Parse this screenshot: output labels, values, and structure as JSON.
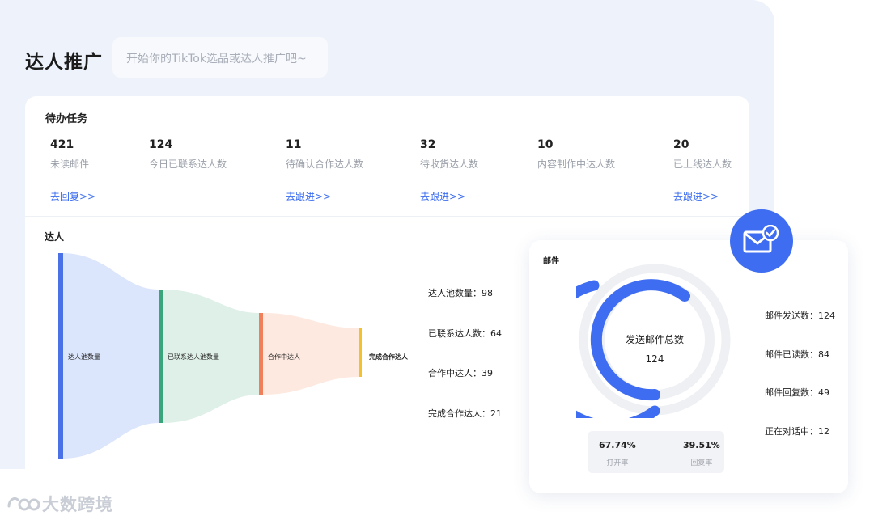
{
  "header": {
    "title": "达人推广",
    "search_placeholder": "开始你的TikTok选品或达人推广吧~"
  },
  "tasks": {
    "heading": "待办任务",
    "items": [
      {
        "count": "421",
        "label": "未读邮件",
        "link": "去回复>>"
      },
      {
        "count": "124",
        "label": "今日已联系达人数",
        "link": ""
      },
      {
        "count": "11",
        "label": "待确认合作达人数",
        "link": "去跟进>>"
      },
      {
        "count": "32",
        "label": "待收货达人数",
        "link": "去跟进>>"
      },
      {
        "count": "10",
        "label": "内容制作中达人数",
        "link": ""
      },
      {
        "count": "20",
        "label": "已上线达人数",
        "link": "去跟进>>"
      }
    ]
  },
  "influencers": {
    "heading": "达人",
    "funnel": [
      {
        "label": "达人池数量",
        "color": "#4a72e6",
        "band": "#dbe5fb"
      },
      {
        "label": "已联系达人池数量",
        "color": "#3aa47a",
        "band": "#dff0e8"
      },
      {
        "label": "合作中达人",
        "color": "#f07f5a",
        "band": "#fde9e0"
      },
      {
        "label": "完成合作达人",
        "color": "#f2c12e",
        "band": ""
      }
    ],
    "stats": [
      "达人池数量：98",
      "已联系达人数：64",
      "合作中达人：39",
      "完成合作达人：21"
    ]
  },
  "mail": {
    "heading": "邮件",
    "center_title": "发送邮件总数",
    "center_value": "124",
    "stats": [
      "邮件发送数：124",
      "邮件已读数：84",
      "邮件回复数：49",
      "正在对话中：12"
    ],
    "open_rate_value": "67.74%",
    "open_rate_label": "打开率",
    "reply_rate_value": "39.51%",
    "reply_rate_label": "回复率",
    "accent": "#3f6df2",
    "track": "#eef0f4",
    "icon": "mail-check-icon"
  },
  "watermark": "大数跨境"
}
